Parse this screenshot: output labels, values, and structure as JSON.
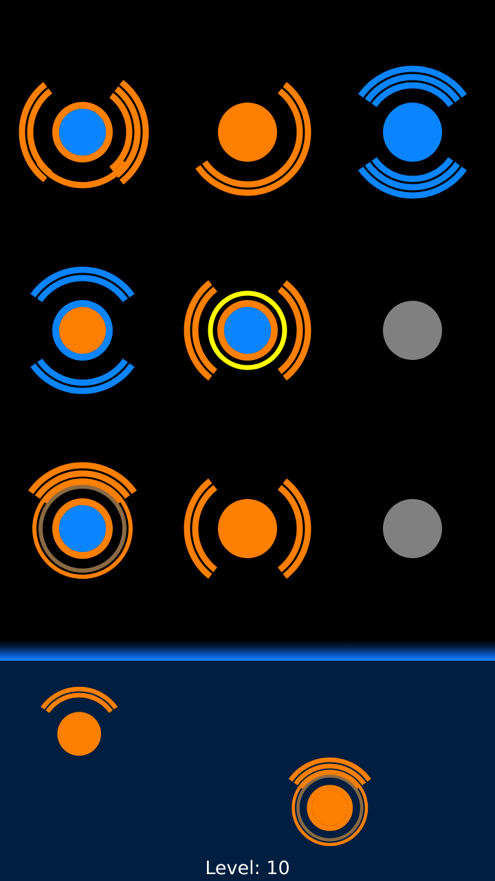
{
  "colors": {
    "orange": "#ff7f00",
    "blue": "#0a84ff",
    "gray": "#808080",
    "brown": "#8a6a44",
    "yellow": "#ffff00",
    "board_bg": "#000000",
    "tray_bg": "#001e3f",
    "divider_glow": "#1a8cff",
    "text": "#ffffff"
  },
  "board": {
    "rows": 3,
    "columns": 3,
    "cells": [
      {
        "id": "r1c1",
        "core": "blue",
        "inner_ring": "orange",
        "outer_ring": null,
        "arcs": [
          {
            "side": "left",
            "count": 2,
            "color": "orange"
          },
          {
            "side": "right",
            "count": 3,
            "color": "orange"
          },
          {
            "side": "bottom",
            "count": 1,
            "color": "orange"
          }
        ],
        "selected": false
      },
      {
        "id": "r1c2",
        "core": "orange",
        "inner_ring": null,
        "outer_ring": null,
        "arcs": [
          {
            "side": "right",
            "count": 2,
            "color": "orange"
          },
          {
            "side": "bottom",
            "count": 2,
            "color": "orange"
          }
        ],
        "selected": false
      },
      {
        "id": "r1c3",
        "core": "blue",
        "inner_ring": null,
        "outer_ring": null,
        "arcs": [
          {
            "side": "top",
            "count": 3,
            "color": "blue"
          },
          {
            "side": "bottom",
            "count": 3,
            "color": "blue"
          }
        ],
        "selected": false
      },
      {
        "id": "r2c1",
        "core": "orange",
        "inner_ring": "blue",
        "outer_ring": null,
        "arcs": [
          {
            "side": "top",
            "count": 2,
            "color": "blue"
          },
          {
            "side": "bottom",
            "count": 2,
            "color": "blue"
          }
        ],
        "selected": false
      },
      {
        "id": "r2c2",
        "core": "blue",
        "inner_ring": "orange",
        "outer_ring": null,
        "arcs": [
          {
            "side": "left",
            "count": 2,
            "color": "orange"
          },
          {
            "side": "right",
            "count": 2,
            "color": "orange"
          }
        ],
        "selected": true
      },
      {
        "id": "r2c3",
        "core": "gray",
        "inner_ring": null,
        "outer_ring": null,
        "arcs": [],
        "selected": false
      },
      {
        "id": "r3c1",
        "core": "blue",
        "inner_ring": "orange",
        "outer_ring": "brown",
        "arcs": [
          {
            "side": "top",
            "count": 3,
            "color": "orange"
          }
        ],
        "selected": false
      },
      {
        "id": "r3c2",
        "core": "orange",
        "inner_ring": null,
        "outer_ring": null,
        "arcs": [
          {
            "side": "left",
            "count": 2,
            "color": "orange"
          },
          {
            "side": "right",
            "count": 2,
            "color": "orange"
          }
        ],
        "selected": false
      },
      {
        "id": "r3c3",
        "core": "gray",
        "inner_ring": null,
        "outer_ring": null,
        "arcs": [],
        "selected": false
      }
    ]
  },
  "tray": {
    "pieces": [
      {
        "id": "tray-piece-1",
        "core": "orange",
        "inner_ring": null,
        "outer_ring": null,
        "arcs": [
          {
            "side": "top",
            "count": 2,
            "color": "orange"
          }
        ]
      },
      {
        "id": "tray-piece-2",
        "core": "orange",
        "inner_ring": "orange",
        "outer_ring": "brown",
        "arcs": [
          {
            "side": "top",
            "count": 3,
            "color": "orange"
          }
        ]
      }
    ]
  },
  "status": {
    "level_label": "Level: 10"
  }
}
